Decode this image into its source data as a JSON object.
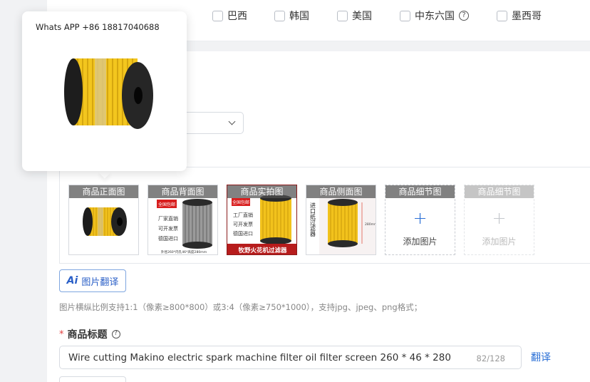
{
  "countries": [
    {
      "label": "巴西"
    },
    {
      "label": "韩国"
    },
    {
      "label": "美国"
    },
    {
      "label": "中东六国"
    },
    {
      "label": "墨西哥"
    }
  ],
  "image_slots": [
    {
      "label": "商品正面图"
    },
    {
      "label": "商品背面图"
    },
    {
      "label": "商品实拍图"
    },
    {
      "label": "商品侧面图"
    },
    {
      "label": "商品细节图",
      "add_text": "添加图片"
    },
    {
      "label": "商品细节图",
      "add_text": "添加图片"
    }
  ],
  "product_photo_text": {
    "back_badge": "全国包邮",
    "back_lines": [
      "厂家直销",
      "可开发票",
      "德国进口"
    ],
    "back_caption": "外径260*内孔46*高度280mm",
    "real_badge": "全国包邮",
    "real_lines": [
      "工厂直销",
      "可开发票",
      "德国进口"
    ],
    "real_caption": "牧野火花机过滤器",
    "side_vertical": "进口纸过滤器",
    "side_dim": "280mm"
  },
  "image_translate": {
    "icon": "Ai",
    "label": "图片翻译"
  },
  "image_hint": "图片横纵比例支持1:1（像素≥800*800）或3:4（像素≥750*1000），支持jpg、jpeg、png格式；",
  "title_field": {
    "required_mark": "*",
    "label": "商品标题",
    "value": "Wire cutting Makino electric spark machine filter oil filter screen 260 * 46 * 280",
    "count": "82/128",
    "translate": "翻译"
  },
  "tooltip": {
    "text": "Whats APP +86 18817040688"
  },
  "colors": {
    "accent": "#2a6fd6",
    "required": "#e34040",
    "filter_yellow": "#f2c21c"
  }
}
